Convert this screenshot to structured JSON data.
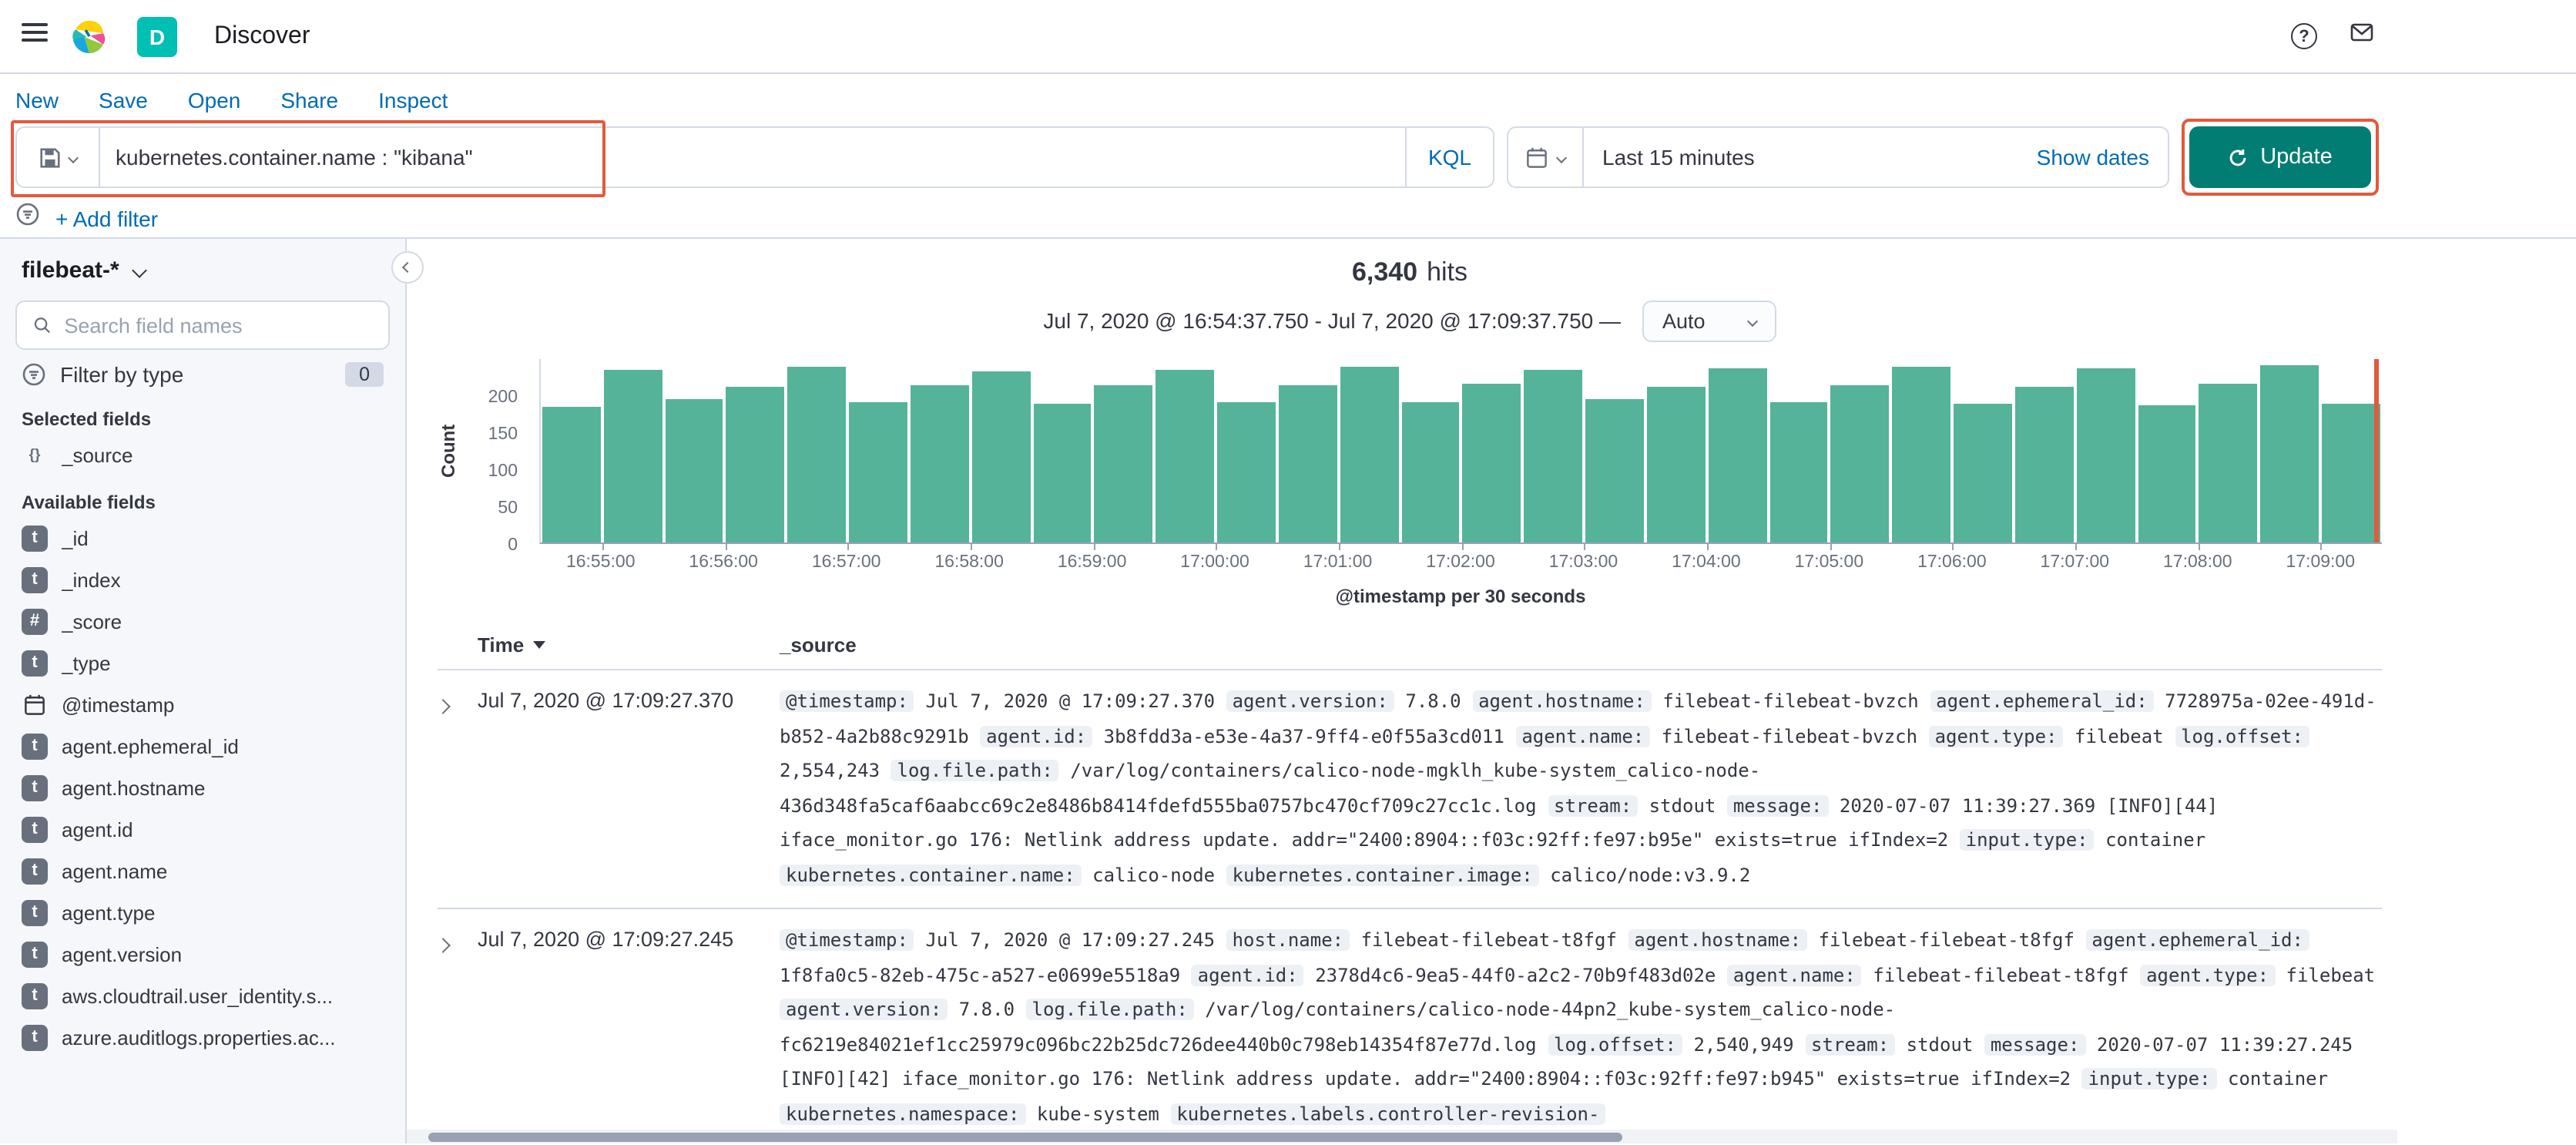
{
  "header": {
    "app_title": "Discover",
    "space_badge": "D"
  },
  "nav": {
    "items": [
      "New",
      "Save",
      "Open",
      "Share",
      "Inspect"
    ]
  },
  "query_bar": {
    "query": "kubernetes.container.name : \"kibana\"",
    "language": "KQL",
    "time_range": "Last 15 minutes",
    "show_dates_label": "Show dates",
    "update_label": "Update"
  },
  "filter_bar": {
    "add_filter_label": "+ Add filter"
  },
  "sidebar": {
    "index_pattern": "filebeat-*",
    "search_placeholder": "Search field names",
    "filter_by_type_label": "Filter by type",
    "filter_count": "0",
    "selected_fields_label": "Selected fields",
    "selected_fields": [
      {
        "name": "_source",
        "type": "source"
      }
    ],
    "available_fields_label": "Available fields",
    "available_fields": [
      {
        "name": "_id",
        "type": "t"
      },
      {
        "name": "_index",
        "type": "t"
      },
      {
        "name": "_score",
        "type": "#"
      },
      {
        "name": "_type",
        "type": "t"
      },
      {
        "name": "@timestamp",
        "type": "date"
      },
      {
        "name": "agent.ephemeral_id",
        "type": "t"
      },
      {
        "name": "agent.hostname",
        "type": "t"
      },
      {
        "name": "agent.id",
        "type": "t"
      },
      {
        "name": "agent.name",
        "type": "t"
      },
      {
        "name": "agent.type",
        "type": "t"
      },
      {
        "name": "agent.version",
        "type": "t"
      },
      {
        "name": "aws.cloudtrail.user_identity.s...",
        "type": "t"
      },
      {
        "name": "azure.auditlogs.properties.ac...",
        "type": "t"
      }
    ]
  },
  "results": {
    "hits_count": "6,340",
    "hits_label": "hits",
    "time_range_label": "Jul 7, 2020 @ 16:54:37.750 - Jul 7, 2020 @ 17:09:37.750 —",
    "interval_label": "Auto"
  },
  "chart_data": {
    "type": "bar",
    "title": "6,340 hits",
    "subtitle": "Jul 7, 2020 @ 16:54:37.750 - Jul 7, 2020 @ 17:09:37.750",
    "interval": "Auto",
    "xlabel": "@timestamp per 30 seconds",
    "ylabel": "Count",
    "ylim": [
      0,
      250
    ],
    "yticks": [
      0,
      50,
      100,
      150,
      200
    ],
    "bucket_seconds": 30,
    "x_tick_labels": [
      "16:55:00",
      "16:56:00",
      "16:57:00",
      "16:58:00",
      "16:59:00",
      "17:00:00",
      "17:01:00",
      "17:02:00",
      "17:03:00",
      "17:04:00",
      "17:05:00",
      "17:06:00",
      "17:07:00",
      "17:08:00",
      "17:09:00"
    ],
    "values": [
      184,
      236,
      196,
      213,
      240,
      192,
      214,
      234,
      190,
      215,
      236,
      192,
      214,
      240,
      191,
      216,
      235,
      196,
      212,
      238,
      191,
      215,
      240,
      190,
      213,
      237,
      187,
      216,
      241,
      189
    ],
    "time_marker_at_end": true,
    "legend": "off"
  },
  "table": {
    "time_header": "Time",
    "source_header": "_source",
    "rows": [
      {
        "time": "Jul 7, 2020 @ 17:09:27.370",
        "fields": [
          {
            "k": "@timestamp:",
            "v": "Jul 7, 2020 @ 17:09:27.370"
          },
          {
            "k": "agent.version:",
            "v": "7.8.0"
          },
          {
            "k": "agent.hostname:",
            "v": "filebeat-filebeat-bvzch"
          },
          {
            "k": "agent.ephemeral_id:",
            "v": "7728975a-02ee-491d-b852-4a2b88c9291b"
          },
          {
            "k": "agent.id:",
            "v": "3b8fdd3a-e53e-4a37-9ff4-e0f55a3cd011"
          },
          {
            "k": "agent.name:",
            "v": "filebeat-filebeat-bvzch"
          },
          {
            "k": "agent.type:",
            "v": "filebeat"
          },
          {
            "k": "log.offset:",
            "v": "2,554,243"
          },
          {
            "k": "log.file.path:",
            "v": "/var/log/containers/calico-node-mgklh_kube-system_calico-node-436d348fa5caf6aabcc69c2e8486b8414fdefd555ba0757bc470cf709c27cc1c.log"
          },
          {
            "k": "stream:",
            "v": "stdout"
          },
          {
            "k": "message:",
            "v": "2020-07-07 11:39:27.369 [INFO][44] iface_monitor.go 176: Netlink address update. addr=\"2400:8904::f03c:92ff:fe97:b95e\" exists=true ifIndex=2"
          },
          {
            "k": "input.type:",
            "v": "container"
          },
          {
            "k": "kubernetes.container.name:",
            "v": "calico-node"
          },
          {
            "k": "kubernetes.container.image:",
            "v": "calico/node:v3.9.2"
          }
        ]
      },
      {
        "time": "Jul 7, 2020 @ 17:09:27.245",
        "fields": [
          {
            "k": "@timestamp:",
            "v": "Jul 7, 2020 @ 17:09:27.245"
          },
          {
            "k": "host.name:",
            "v": "filebeat-filebeat-t8fgf"
          },
          {
            "k": "agent.hostname:",
            "v": "filebeat-filebeat-t8fgf"
          },
          {
            "k": "agent.ephemeral_id:",
            "v": "1f8fa0c5-82eb-475c-a527-e0699e5518a9"
          },
          {
            "k": "agent.id:",
            "v": "2378d4c6-9ea5-44f0-a2c2-70b9f483d02e"
          },
          {
            "k": "agent.name:",
            "v": "filebeat-filebeat-t8fgf"
          },
          {
            "k": "agent.type:",
            "v": "filebeat"
          },
          {
            "k": "agent.version:",
            "v": "7.8.0"
          },
          {
            "k": "log.file.path:",
            "v": "/var/log/containers/calico-node-44pn2_kube-system_calico-node-fc6219e84021ef1cc25979c096bc22b25dc726dee440b0c798eb14354f87e77d.log"
          },
          {
            "k": "log.offset:",
            "v": "2,540,949"
          },
          {
            "k": "stream:",
            "v": "stdout"
          },
          {
            "k": "message:",
            "v": "2020-07-07 11:39:27.245 [INFO][42] iface_monitor.go 176: Netlink address update. addr=\"2400:8904::f03c:92ff:fe97:b945\" exists=true ifIndex=2"
          },
          {
            "k": "input.type:",
            "v": "container"
          },
          {
            "k": "kubernetes.namespace:",
            "v": "kube-system"
          },
          {
            "k": "kubernetes.labels.controller-revision-",
            "v": ""
          }
        ]
      }
    ]
  },
  "colors": {
    "link_blue": "#006BB4",
    "space_badge_teal": "#00BFB3",
    "update_button_teal": "#017D73",
    "histogram_bar_green": "#54B399",
    "annotation_red": "#E4593C",
    "border_gray": "#D3DAE6"
  },
  "icons": {
    "menu-icon": "hamburger-lines",
    "elastic-logo": "multicolor-cluster",
    "help-icon": "question-circle",
    "newsfeed-icon": "envelope",
    "save-query-icon": "floppy-disk",
    "calendar-icon": "calendar",
    "filter-icon": "funnel-in-circle",
    "search-icon": "magnifier",
    "refresh-icon": "circular-arrow",
    "collapse-icon": "chevron-left-circle",
    "sort-descending-icon": "triangle-down",
    "expand-icon": "chevron-right"
  }
}
